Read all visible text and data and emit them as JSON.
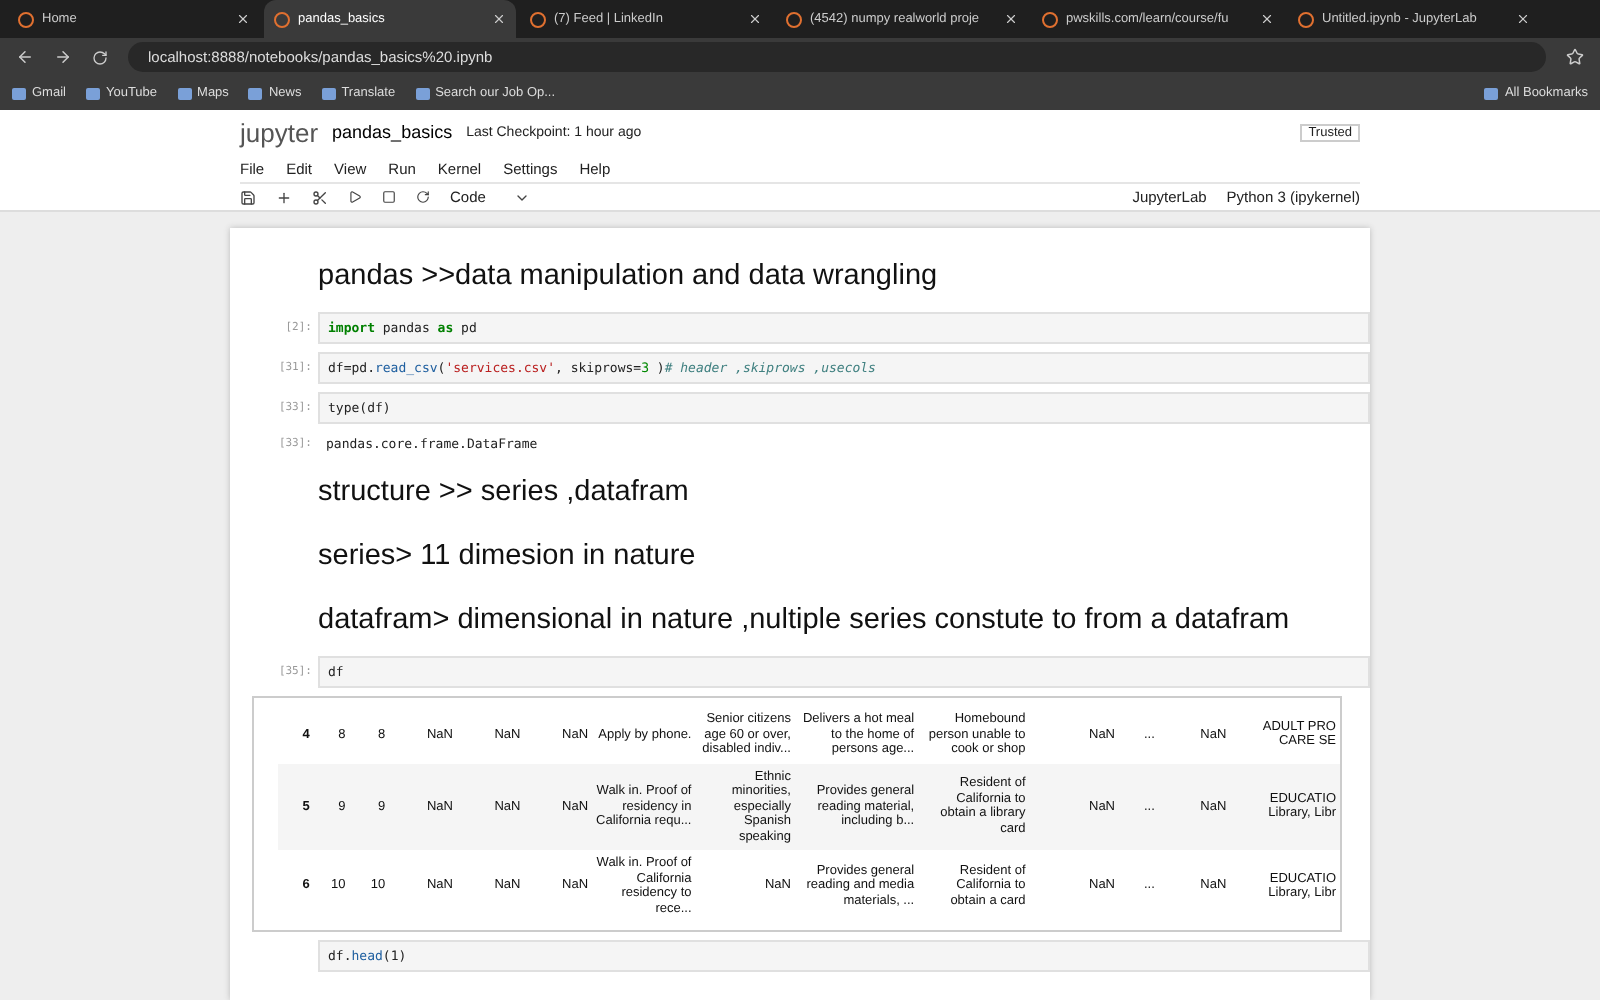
{
  "browser": {
    "tabs": [
      {
        "title": "Home",
        "selected": false
      },
      {
        "title": "pandas_basics",
        "selected": true
      },
      {
        "title": "(7) Feed | LinkedIn",
        "selected": false
      },
      {
        "title": "(4542) numpy realworld proje",
        "selected": false
      },
      {
        "title": "pwskills.com/learn/course/fu",
        "selected": false
      },
      {
        "title": "Untitled.ipynb - JupyterLab",
        "selected": false
      }
    ],
    "address": "localhost:8888/notebooks/pandas_basics%20.ipynb",
    "bookmarks": [
      "Gmail",
      "YouTube",
      "Maps",
      "News",
      "Translate",
      "Search our Job Op..."
    ],
    "all_bookmarks": "All Bookmarks"
  },
  "jupyter": {
    "logo": "jupyter",
    "notebook": "pandas_basics",
    "checkpoint": "Last Checkpoint: 1 hour ago",
    "trusted": "Trusted",
    "menus": [
      "File",
      "Edit",
      "View",
      "Run",
      "Kernel",
      "Settings",
      "Help"
    ],
    "cell_type": "Code",
    "jupyterlab": "JupyterLab",
    "kernel": "Python 3 (ipykernel)"
  },
  "cells": [
    {
      "kind": "markdown",
      "text": "pandas >>data manipulation and data wrangling"
    },
    {
      "kind": "code",
      "prompt": "[2]:",
      "tokens": [
        {
          "kind": "keyword",
          "s": "import"
        },
        {
          "kind": "plain",
          "s": " pandas "
        },
        {
          "kind": "keyword",
          "s": "as"
        },
        {
          "kind": "plain",
          "s": " pd"
        }
      ]
    },
    {
      "kind": "code",
      "prompt": "[31]:",
      "tokens": [
        {
          "kind": "plain",
          "s": "df=pd."
        },
        {
          "kind": "function",
          "s": "read_csv"
        },
        {
          "kind": "plain",
          "s": "("
        },
        {
          "kind": "string",
          "s": "'services.csv'"
        },
        {
          "kind": "plain",
          "s": ", skiprows="
        },
        {
          "kind": "number",
          "s": "3"
        },
        {
          "kind": "plain",
          "s": " )"
        },
        {
          "kind": "comment",
          "s": "# header ,skiprows ,usecols"
        }
      ]
    },
    {
      "kind": "code",
      "prompt": "[33]:",
      "tokens": [
        {
          "kind": "plain",
          "s": "type(df)"
        }
      ]
    },
    {
      "kind": "output",
      "prompt": "[33]:",
      "text": "pandas.core.frame.DataFrame"
    },
    {
      "kind": "markdown",
      "text": "structure >> series ,datafram"
    },
    {
      "kind": "markdown",
      "text": "series> 11 dimesion in nature"
    },
    {
      "kind": "markdown",
      "text": "datafram> dimensional in nature ,nultiple series constute to from a datafram"
    },
    {
      "kind": "code",
      "prompt": "[35]:",
      "tokens": [
        {
          "kind": "plain",
          "s": "df"
        }
      ]
    },
    {
      "kind": "table",
      "rows": [
        [
          "4",
          "8",
          "8",
          "NaN",
          "NaN",
          "NaN",
          "Apply by phone.",
          "Senior citizens age 60 or over, disabled indiv...",
          "Delivers a hot meal to the home of persons age...",
          "Homebound person unable to cook or shop",
          "NaN",
          "...",
          "NaN",
          "ADULT PRO CARE SE"
        ],
        [
          "5",
          "9",
          "9",
          "NaN",
          "NaN",
          "NaN",
          "Walk in. Proof of residency in California requ...",
          "Ethnic minorities, especially Spanish speaking",
          "Provides general reading material, including b...",
          "Resident of California to obtain a library card",
          "NaN",
          "...",
          "NaN",
          "EDUCATIO Library, Libr"
        ],
        [
          "6",
          "10",
          "10",
          "NaN",
          "NaN",
          "NaN",
          "Walk in. Proof of California residency to rece...",
          "NaN",
          "Provides general reading and media materials, ...",
          "Resident of California to obtain a card",
          "NaN",
          "...",
          "NaN",
          "EDUCATIO Library, Libr"
        ]
      ]
    },
    {
      "kind": "code",
      "tokens": [
        {
          "kind": "plain",
          "s": "df."
        },
        {
          "kind": "function",
          "s": "head"
        },
        {
          "kind": "plain",
          "s": "(1)"
        }
      ]
    }
  ]
}
